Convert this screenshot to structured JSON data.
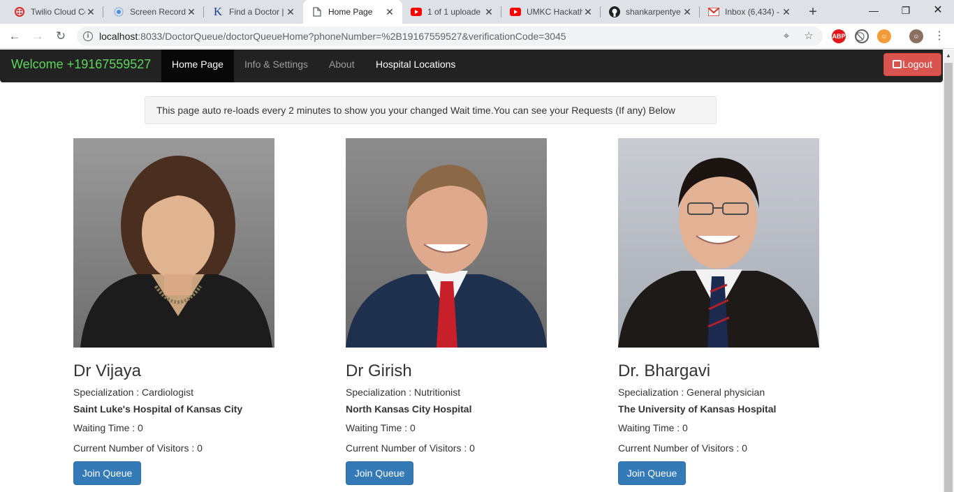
{
  "browser": {
    "tabs": [
      {
        "title": "Twilio Cloud Co",
        "icon": "twilio-icon",
        "color": "#e22525"
      },
      {
        "title": "Screen Record",
        "icon": "screen-record-icon",
        "color": "#4a90e2"
      },
      {
        "title": "Find a Doctor |",
        "icon": "k-logo-icon",
        "color": "#1a3f8f"
      },
      {
        "title": "Home Page",
        "icon": "page-icon",
        "color": "#5f6368"
      },
      {
        "title": "1 of 1 uploade",
        "icon": "youtube-icon",
        "color": "#ff0000"
      },
      {
        "title": "UMKC Hackath",
        "icon": "youtube-icon",
        "color": "#ff0000"
      },
      {
        "title": "shankarpentye",
        "icon": "github-icon",
        "color": "#202124"
      },
      {
        "title": "Inbox (6,434) -",
        "icon": "gmail-icon",
        "color": "#d93025"
      }
    ],
    "url_host": "localhost",
    "url_rest": ":8033/DoctorQueue/doctorQueueHome?phoneNumber=%2B19167559527&verificationCode=3045",
    "ext_abp": "ABP"
  },
  "navbar": {
    "brand": "Welcome +19167559527",
    "links": [
      "Home Page",
      "Info & Settings",
      "About",
      "Hospital Locations"
    ],
    "logout_label": "Logout"
  },
  "alert_text": "This page auto re-loads every 2 minutes to show you your changed Wait time.You can see your Requests (If any) Below",
  "doctors": [
    {
      "name": "Dr Vijaya",
      "specialization": "Specialization : Cardiologist",
      "hospital": "Saint Luke's Hospital of Kansas City",
      "waiting": "Waiting Time : 0",
      "visitors": "Current Number of Visitors : 0",
      "button": "Join Queue"
    },
    {
      "name": "Dr Girish",
      "specialization": "Specialization : Nutritionist",
      "hospital": "North Kansas City Hospital",
      "waiting": "Waiting Time : 0",
      "visitors": "Current Number of Visitors : 0",
      "button": "Join Queue"
    },
    {
      "name": "Dr. Bhargavi",
      "specialization": "Specialization : General physician",
      "hospital": "The University of Kansas Hospital",
      "waiting": "Waiting Time : 0",
      "visitors": "Current Number of Visitors : 0",
      "button": "Join Queue"
    }
  ],
  "colors": {
    "brand": "#5cd65c",
    "navbar_bg": "#222222",
    "logout": "#d9534f",
    "primary_button": "#337ab7"
  }
}
